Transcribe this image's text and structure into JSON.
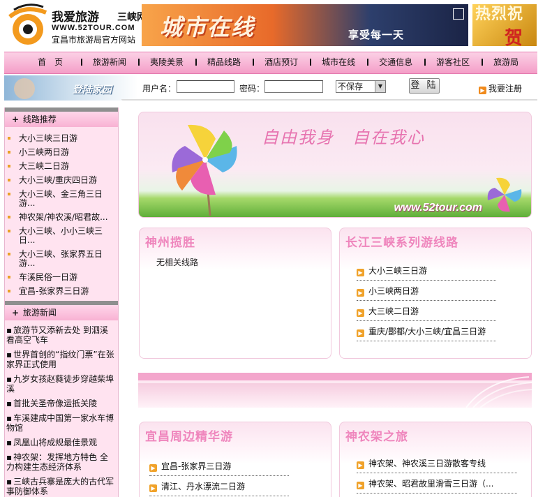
{
  "header": {
    "site_name": "我爱旅游",
    "site_name_sub": "三峡网",
    "site_url": "WWW.52TOUR.COM",
    "site_desc": "宜昌市旅游局官方网站",
    "banner_big": "城市在线",
    "banner_slogan": "享受每一天",
    "banner_celebrate_text": "热烈祝",
    "banner_celebrate_char": "贺"
  },
  "nav": {
    "items": [
      {
        "label": "首　页"
      },
      {
        "label": "旅游新闻"
      },
      {
        "label": "夷陵美景"
      },
      {
        "label": "精品线路"
      },
      {
        "label": "酒店预订"
      },
      {
        "label": "城市在线"
      },
      {
        "label": "交通信息"
      },
      {
        "label": "游客社区"
      },
      {
        "label": "旅游局"
      }
    ]
  },
  "login": {
    "badge_text": "登陆家园",
    "username_label": "用户名：",
    "password_label": "密码：",
    "save_option": "不保存",
    "submit_label": "登 陆",
    "register_label": "我要注册"
  },
  "sidebar": {
    "routes_title": "线路推荐",
    "routes": [
      "大小三峡三日游",
      "小三峡两日游",
      "大三峡二日游",
      "大小三峡/重庆四日游",
      "大小三峡、金三角三日游...",
      "神农架/神农溪/昭君故...",
      "大小三峡、小小三峡三日...",
      "大小三峡、张家界五日游...",
      "车溪民俗一日游",
      "宜昌-张家界三日游"
    ],
    "news_title": "旅游新闻",
    "news": [
      "旅游节又添新去处 到泗溪看高空飞车",
      "世界首创的“指纹门票”在张家界正式使用",
      "九岁女孩赵蕤徒步穿越柴埠溪",
      "首批关圣帝像运抵关陵",
      "车溪建成中国第一家水车博物馆",
      "凤凰山将成规最佳景观",
      "神农架：发挥地方特色 全力构建生态经济体系",
      "三峡古兵寨是庞大的古代军事防御体系"
    ]
  },
  "hero": {
    "title": "自由我身　自在我心",
    "url": "www.52tour.com"
  },
  "panels": {
    "shenzhou": {
      "title": "神州揽胜",
      "empty": "无相关线路"
    },
    "changjiang": {
      "title": "长江三峡系列游线路",
      "items": [
        "大小三峡三日游",
        "小三峡两日游",
        "大三峡二日游",
        "重庆/酆都/大小三峡/宜昌三日游"
      ]
    },
    "yichang": {
      "title": "宜昌周边精华游",
      "items": [
        "宜昌-张家界三日游",
        "清江、丹水漂流二日游"
      ]
    },
    "shennongjia": {
      "title": "神农架之旅",
      "items": [
        "神农架、神农溪三日游散客专线",
        "神农架、昭君故里滑雪三日游（..."
      ]
    }
  },
  "colors": {
    "accent_pink": "#f49ec7",
    "panel_title": "#ef86bd",
    "bullet_orange": "#e9a126"
  }
}
